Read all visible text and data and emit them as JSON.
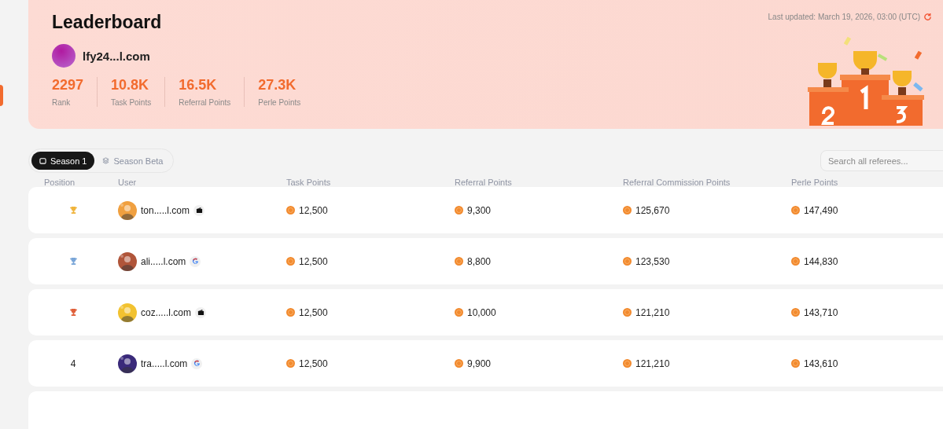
{
  "header": {
    "title": "Leaderboard",
    "last_updated": "Last updated: March 19, 2026, 03:00 (UTC)",
    "user": {
      "name": "lfy24...l.com"
    },
    "stats": [
      {
        "value": "2297",
        "label": "Rank"
      },
      {
        "value": "10.8K",
        "label": "Task Points"
      },
      {
        "value": "16.5K",
        "label": "Referral Points"
      },
      {
        "value": "27.3K",
        "label": "Perle Points"
      }
    ]
  },
  "tabs": [
    {
      "label": "Season 1",
      "selected": true
    },
    {
      "label": "Season Beta",
      "selected": false
    }
  ],
  "search": {
    "placeholder": "Search all referees..."
  },
  "table": {
    "columns": [
      "Position",
      "User",
      "Task Points",
      "Referral Points",
      "Referral Commission Points",
      "Perle Points"
    ],
    "rows": [
      {
        "position": {
          "kind": "trophy",
          "color": "#f0b43c"
        },
        "user": "ton.....l.com",
        "login": {
          "kind": "wallet"
        },
        "task": "12,500",
        "referral": "9,300",
        "commission": "125,670",
        "perle": "147,490"
      },
      {
        "position": {
          "kind": "trophy",
          "color": "#7aa6d8"
        },
        "user": "ali.....l.com",
        "login": {
          "kind": "google"
        },
        "task": "12,500",
        "referral": "8,800",
        "commission": "123,530",
        "perle": "144,830"
      },
      {
        "position": {
          "kind": "trophy",
          "color": "#e0603a"
        },
        "user": "coz.....l.com",
        "login": {
          "kind": "wallet"
        },
        "task": "12,500",
        "referral": "10,000",
        "commission": "121,210",
        "perle": "143,710"
      },
      {
        "position": {
          "kind": "number",
          "text": "4"
        },
        "user": "tra.....l.com",
        "login": {
          "kind": "google"
        },
        "task": "12,500",
        "referral": "9,900",
        "commission": "121,210",
        "perle": "143,610"
      }
    ]
  }
}
